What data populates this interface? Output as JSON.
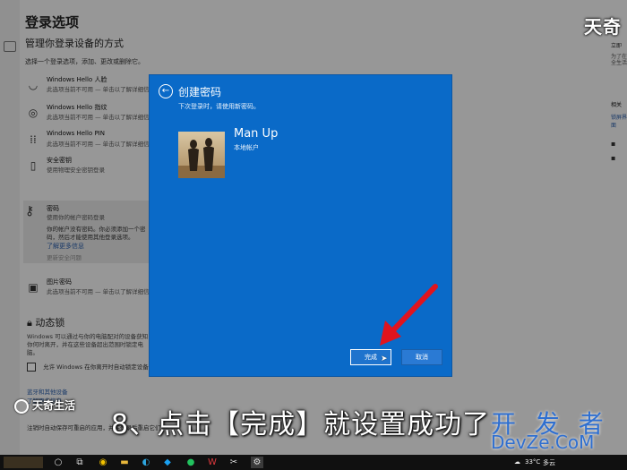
{
  "settings": {
    "title": "登录选项",
    "subtitle": "管理你登录设备的方式",
    "hint": "选择一个登录选项，添加、更改或删除它。",
    "options": [
      {
        "label": "Windows Hello 人脸",
        "desc": "此选项当前不可用 — 单击以了解详细信息",
        "icon": "face-icon"
      },
      {
        "label": "Windows Hello 指纹",
        "desc": "此选项当前不可用 — 单击以了解详细信息",
        "icon": "fingerprint-icon"
      },
      {
        "label": "Windows Hello PIN",
        "desc": "此选项当前不可用 — 单击以了解详细信息",
        "icon": "pin-keypad-icon"
      },
      {
        "label": "安全密钥",
        "desc": "使用物理安全密钥登录",
        "icon": "usb-key-icon"
      }
    ],
    "password": {
      "label": "密码",
      "desc": "使用你的帐户密码登录",
      "detail": "你的帐户没有密码。你必须添加一个密码，然后才能使用其他登录选项。",
      "link": "更新安全问题"
    },
    "learn_more": "了解更多信息",
    "picture_password": {
      "label": "图片密码",
      "desc": "此选项当前不可用 — 单击以了解详细信息"
    },
    "dynamic_lock": {
      "title": "动态锁",
      "desc": "Windows 可以通过与你的电脑配对的设备获知你何时离开，并在这些设备超出范围时锁定电脑。",
      "checkbox": "允许 Windows 在你离开时自动锁定设备"
    },
    "bluetooth_link": "蓝牙和其他设备",
    "security_link": "了解更多信息",
    "footer": "注销时自动保存可重启的应用，并在登录后重启它们。"
  },
  "right_panel": {
    "logo": "天奇",
    "text1": "立即",
    "text2": "为了在全生活",
    "heading": "相关",
    "link": "锁屏界面"
  },
  "dialog": {
    "title": "创建密码",
    "subtitle": "下次登录时，请使用新密码。",
    "user_name": "Man Up",
    "account_type": "本地帐户",
    "finish_label": "完成",
    "cancel_label": "取消"
  },
  "overlay": {
    "caption": "8、点击【完成】就设置成功了",
    "brand": "天奇生活",
    "watermark_line1": "开 发 者",
    "watermark_line2": "DevZe.CoM"
  },
  "taskbar": {
    "temperature": "33°C",
    "weather": "多云"
  },
  "colors": {
    "dialog_blue": "#0a6ac8",
    "arrow_red": "#e0141e",
    "link_blue": "#2b5ea8"
  }
}
